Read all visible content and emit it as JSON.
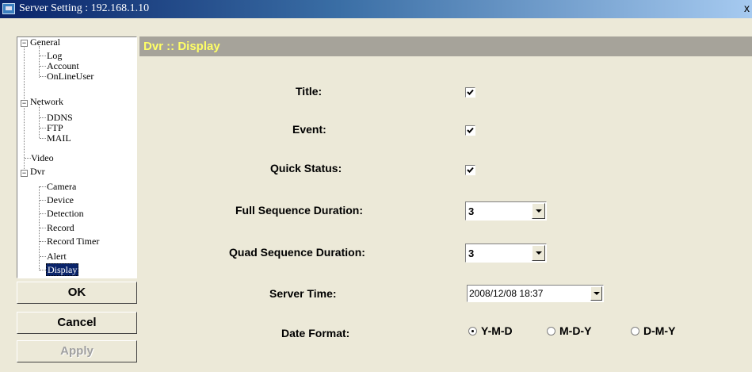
{
  "window": {
    "title": "Server Setting : 192.168.1.10",
    "close_label": "x"
  },
  "tree": {
    "general": "General",
    "log": "Log",
    "account": "Account",
    "online_user": "OnLineUser",
    "network": "Network",
    "ddns": "DDNS",
    "ftp": "FTP",
    "mail": "MAIL",
    "video": "Video",
    "dvr": "Dvr",
    "camera": "Camera",
    "device": "Device",
    "detection": "Detection",
    "record": "Record",
    "record_timer": "Record Timer",
    "alert": "Alert",
    "display": "Display",
    "expander_symbol": "−"
  },
  "buttons": {
    "ok": "OK",
    "cancel": "Cancel",
    "apply": "Apply"
  },
  "header": {
    "title": "Dvr :: Display"
  },
  "form": {
    "title_label": "Title:",
    "title_checked": true,
    "event_label": "Event:",
    "event_checked": true,
    "quick_status_label": "Quick Status:",
    "quick_status_checked": true,
    "full_seq_label": "Full Sequence Duration:",
    "full_seq_value": "3",
    "quad_seq_label": "Quad Sequence Duration:",
    "quad_seq_value": "3",
    "server_time_label": "Server Time:",
    "server_time_value": "2008/12/08 18:37",
    "date_format_label": "Date Format:",
    "date_format_options": [
      "Y-M-D",
      "M-D-Y",
      "D-M-Y"
    ],
    "date_format_selected": "Y-M-D"
  },
  "colors": {
    "header_text": "#ffff66",
    "header_bg": "#a6a39a",
    "selection": "#0a246a",
    "title_bar": "#0a246a"
  }
}
